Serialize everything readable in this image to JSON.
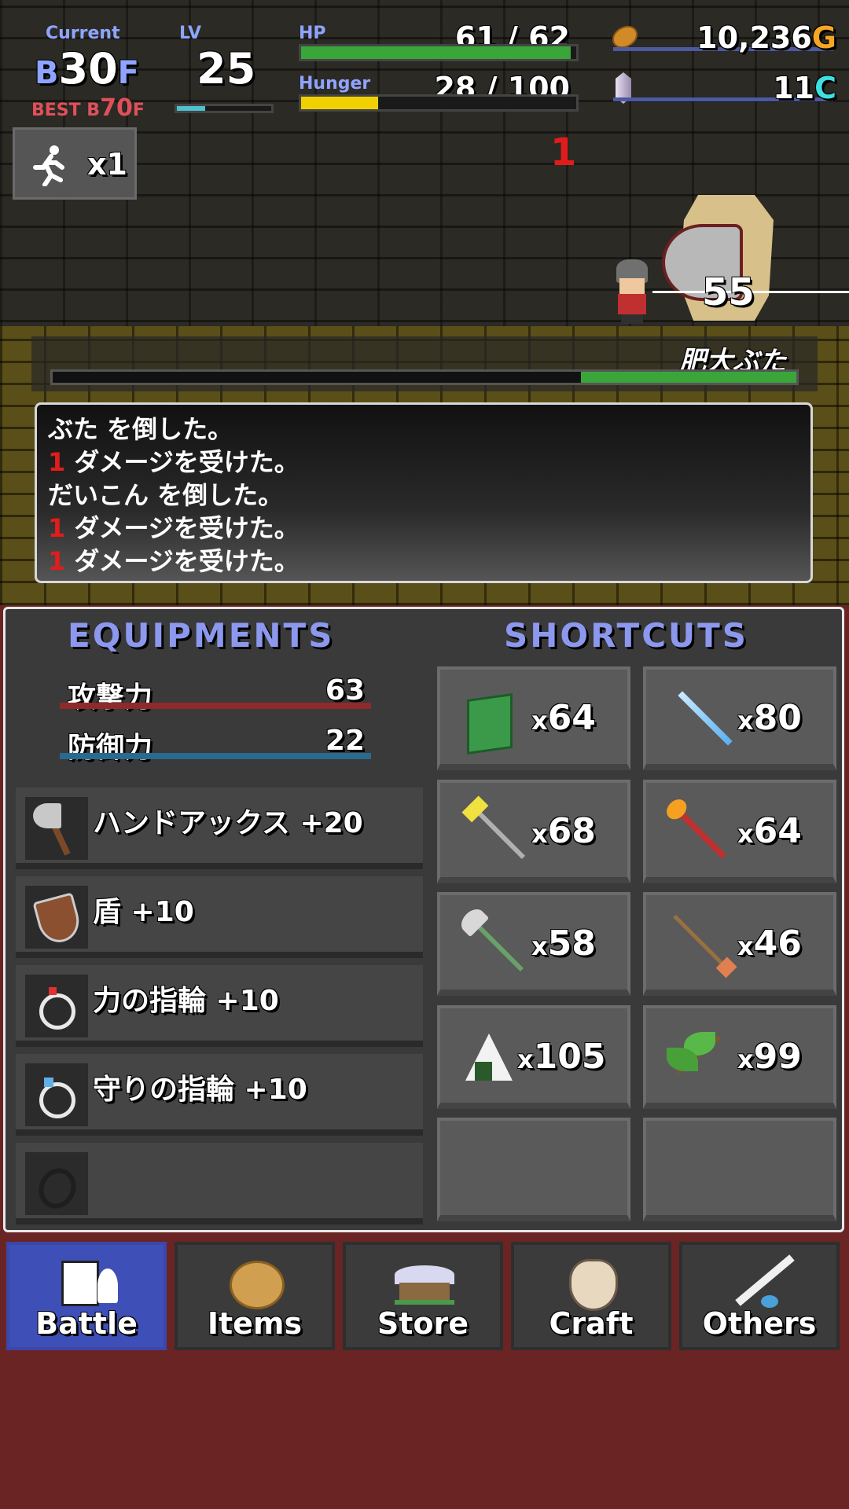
{
  "hud": {
    "current_label": "Current",
    "floor_prefix": "B",
    "floor_number": "30",
    "floor_suffix": "F",
    "best_label": "BEST B",
    "best_number": "70",
    "best_suffix": "F",
    "lv_label": "LV",
    "lv_value": "25",
    "lv_progress": 0.3,
    "hp_label": "HP",
    "hp_value": "61 / 62",
    "hp_fraction": 0.98,
    "hunger_label": "Hunger",
    "hunger_value": "28 / 100",
    "hunger_fraction": 0.28,
    "gold_value": "10,236",
    "gold_unit": "G",
    "crystal_value": "11",
    "crystal_unit": "C",
    "speed_label": "x1"
  },
  "battle": {
    "damage_popup_red": "1",
    "damage_popup_white": "55",
    "enemy_name": "肥大ぶた",
    "enemy_hp_fraction": 0.29
  },
  "log": [
    {
      "red": "",
      "text": "ぶた を倒した。"
    },
    {
      "red": "1",
      "text": " ダメージを受けた。"
    },
    {
      "red": "",
      "text": "だいこん を倒した。"
    },
    {
      "red": "1",
      "text": " ダメージを受けた。"
    },
    {
      "red": "1",
      "text": " ダメージを受けた。"
    }
  ],
  "equipments": {
    "title": "EQUIPMENTS",
    "attack_label": "攻撃力",
    "attack_value": "63",
    "defense_label": "防御力",
    "defense_value": "22",
    "slots": [
      {
        "label": "ハンドアックス +20",
        "icon": "hand-axe-icon"
      },
      {
        "label": "盾 +10",
        "icon": "shield-icon"
      },
      {
        "label": "力の指輪 +10",
        "icon": "power-ring-icon"
      },
      {
        "label": "守りの指輪 +10",
        "icon": "guard-ring-icon"
      },
      {
        "label": "",
        "icon": "empty-ring-slot-icon"
      }
    ]
  },
  "shortcuts": {
    "title": "SHORTCUTS",
    "items": [
      {
        "count": "64",
        "icon": "green-book-icon"
      },
      {
        "count": "80",
        "icon": "ice-sword-icon"
      },
      {
        "count": "68",
        "icon": "thunder-trident-icon"
      },
      {
        "count": "64",
        "icon": "fire-staff-icon"
      },
      {
        "count": "58",
        "icon": "poleaxe-icon"
      },
      {
        "count": "46",
        "icon": "arrow-icon"
      },
      {
        "count": "105",
        "icon": "rice-ball-icon"
      },
      {
        "count": "99",
        "icon": "herb-icon"
      }
    ]
  },
  "nav": {
    "tabs": [
      {
        "label": "Battle",
        "icon": "battle-scroll-icon",
        "active": true
      },
      {
        "label": "Items",
        "icon": "item-bag-icon",
        "active": false
      },
      {
        "label": "Store",
        "icon": "store-house-icon",
        "active": false
      },
      {
        "label": "Craft",
        "icon": "craft-sack-icon",
        "active": false
      },
      {
        "label": "Others",
        "icon": "quill-pen-icon",
        "active": false
      }
    ]
  },
  "colors": {
    "accent_blue": "#8c98ee",
    "hp_green": "#3aa63a",
    "hunger_yellow": "#f0d000",
    "gold_orange": "#f5a623",
    "crystal_cyan": "#3fe0e0",
    "active_tab": "#3f4fb8",
    "damage_red": "#e21c1c"
  }
}
